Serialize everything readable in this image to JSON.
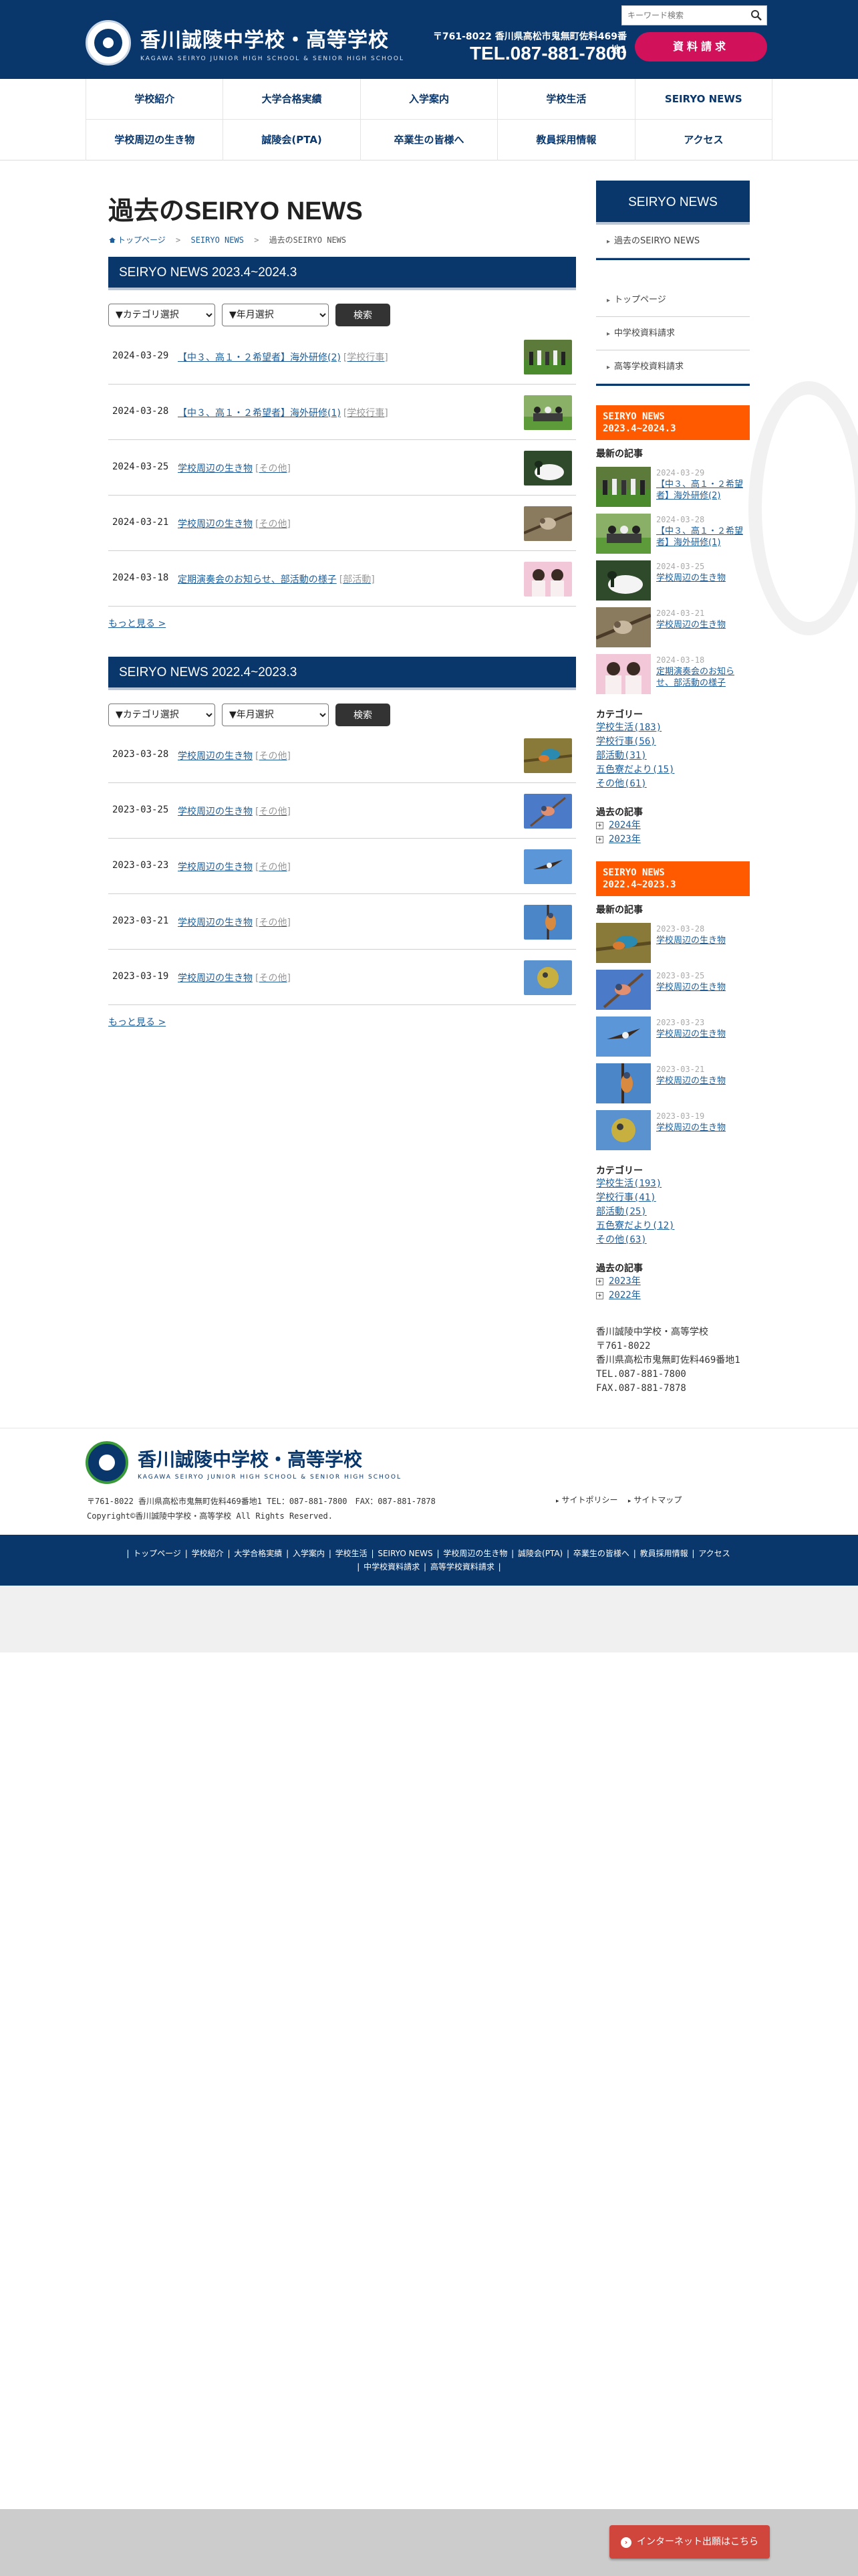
{
  "header": {
    "school_name": "香川誠陵中学校・高等学校",
    "school_name_en": "KAGAWA SEIRYO JUNIOR HIGH SCHOOL & SENIOR HIGH SCHOOL",
    "search_placeholder": "キーワード検索",
    "address": "〒761-8022 香川県高松市鬼無町佐料469番地1",
    "tel": "TEL.087-881-7800",
    "request_label": "資料請求"
  },
  "nav": {
    "row1": [
      "学校紹介",
      "大学合格実績",
      "入学案内",
      "学校生活",
      "SEIRYO NEWS"
    ],
    "row2": [
      "学校周辺の生き物",
      "誠陵会(PTA)",
      "卒業生の皆様へ",
      "教員採用情報",
      "アクセス"
    ]
  },
  "page": {
    "title": "過去のSEIRYO NEWS",
    "breadcrumb": [
      "トップページ",
      "SEIRYO NEWS",
      "過去のSEIRYO NEWS"
    ]
  },
  "filters": {
    "category": "▼カテゴリ選択",
    "month": "▼年月選択",
    "button": "検索"
  },
  "sections": [
    {
      "heading": "SEIRYO NEWS 2023.4~2024.3",
      "items": [
        {
          "date": "2024-03-29",
          "title": "【中３、高１・２希望者】海外研修(2)",
          "category": "[学校行事]"
        },
        {
          "date": "2024-03-28",
          "title": "【中３、高１・２希望者】海外研修(1)",
          "category": "[学校行事]"
        },
        {
          "date": "2024-03-25",
          "title": "学校周辺の生き物",
          "category": "[その他]"
        },
        {
          "date": "2024-03-21",
          "title": "学校周辺の生き物",
          "category": "[その他]"
        },
        {
          "date": "2024-03-18",
          "title": "定期演奏会のお知らせ、部活動の様子",
          "category": "[部活動]"
        }
      ],
      "more": "もっと見る"
    },
    {
      "heading": "SEIRYO NEWS 2022.4~2023.3",
      "items": [
        {
          "date": "2023-03-28",
          "title": "学校周辺の生き物",
          "category": "[その他]"
        },
        {
          "date": "2023-03-25",
          "title": "学校周辺の生き物",
          "category": "[その他]"
        },
        {
          "date": "2023-03-23",
          "title": "学校周辺の生き物",
          "category": "[その他]"
        },
        {
          "date": "2023-03-21",
          "title": "学校周辺の生き物",
          "category": "[その他]"
        },
        {
          "date": "2023-03-19",
          "title": "学校周辺の生き物",
          "category": "[その他]"
        }
      ],
      "more": "もっと見る"
    }
  ],
  "sidebar": {
    "heading": "SEIRYO NEWS",
    "link_past": "過去のSEIRYO NEWS",
    "links": [
      "トップページ",
      "中学校資料請求",
      "高等学校資料請求"
    ],
    "latest_label": "最新の記事",
    "category_label": "カテゴリー",
    "archive_label": "過去の記事",
    "blocks": [
      {
        "heading_line1": "SEIRYO NEWS",
        "heading_line2": "2023.4~2024.3",
        "news": [
          {
            "date": "2024-03-29",
            "title": "【中３、高１・２希望者】海外研修(2)"
          },
          {
            "date": "2024-03-28",
            "title": "【中３、高１・２希望者】海外研修(1)"
          },
          {
            "date": "2024-03-25",
            "title": "学校周辺の生き物"
          },
          {
            "date": "2024-03-21",
            "title": "学校周辺の生き物"
          },
          {
            "date": "2024-03-18",
            "title": "定期演奏会のお知らせ、部活動の様子"
          }
        ],
        "categories": [
          "学校生活(183)",
          "学校行事(56)",
          "部活動(31)",
          "五色寮だより(15)",
          "その他(61)"
        ],
        "archives": [
          "2024年",
          "2023年"
        ]
      },
      {
        "heading_line1": "SEIRYO NEWS",
        "heading_line2": "2022.4~2023.3",
        "news": [
          {
            "date": "2023-03-28",
            "title": "学校周辺の生き物"
          },
          {
            "date": "2023-03-25",
            "title": "学校周辺の生き物"
          },
          {
            "date": "2023-03-23",
            "title": "学校周辺の生き物"
          },
          {
            "date": "2023-03-21",
            "title": "学校周辺の生き物"
          },
          {
            "date": "2023-03-19",
            "title": "学校周辺の生き物"
          }
        ],
        "categories": [
          "学校生活(193)",
          "学校行事(41)",
          "部活動(25)",
          "五色寮だより(12)",
          "その他(63)"
        ],
        "archives": [
          "2023年",
          "2022年"
        ]
      }
    ],
    "address": [
      "香川誠陵中学校・高等学校",
      "〒761-8022",
      "香川県高松市鬼無町佐料469番地1",
      "TEL.087-881-7800",
      "FAX.087-881-7878"
    ]
  },
  "footer": {
    "school_name": "香川誠陵中学校・高等学校",
    "school_name_en": "KAGAWA SEIRYO JUNIOR HIGH SCHOOL & SENIOR HIGH SCHOOL",
    "address_line": "〒761-8022 香川県高松市鬼無町佐料469番地1 TEL：087-881-7800　FAX：087-881-7878",
    "copyright": "Copyright©香川誠陵中学校・高等学校 All Rights Reserved.",
    "links": [
      "サイトポリシー",
      "サイトマップ"
    ],
    "nav_row1": [
      "トップページ",
      "学校紹介",
      "大学合格実績",
      "入学案内",
      "学校生活",
      "SEIRYO NEWS",
      "学校周辺の生き物",
      "誠陵会(PTA)",
      "卒業生の皆様へ",
      "教員採用情報",
      "アクセス"
    ],
    "nav_row2": [
      "中学校資料請求",
      "高等学校資料請求"
    ],
    "apply_label": "インターネット出願はこちら"
  },
  "colors": {
    "navy": "#0a376b",
    "orange": "#ff5a00",
    "pink": "#d1125a",
    "link": "#1e5d99"
  }
}
